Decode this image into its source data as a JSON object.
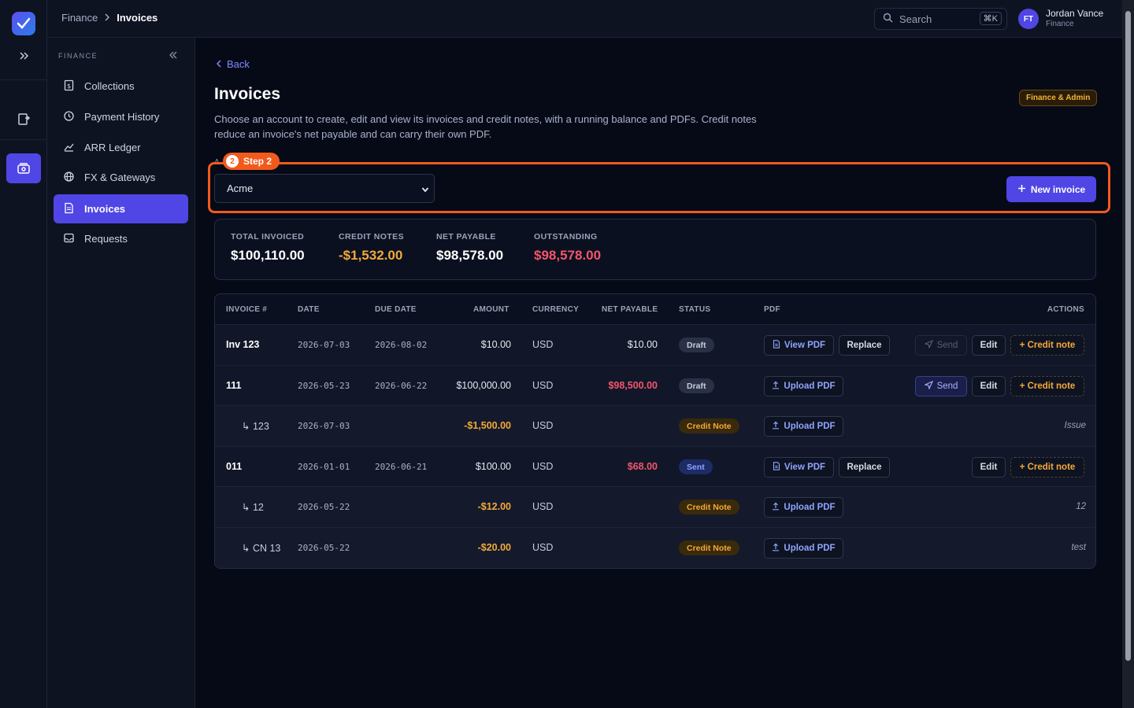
{
  "app": {
    "user_initials": "FT",
    "user_name": "Jordan Vance",
    "user_role": "Finance"
  },
  "breadcrumb": {
    "parent": "Finance",
    "current": "Invoices"
  },
  "search": {
    "placeholder": "Search",
    "shortcut": "⌘K"
  },
  "sidebar": {
    "section": "FINANCE",
    "items": [
      {
        "label": "Collections",
        "icon": "dollar-doc-icon"
      },
      {
        "label": "Payment History",
        "icon": "history-icon"
      },
      {
        "label": "ARR Ledger",
        "icon": "chart-icon"
      },
      {
        "label": "FX & Gateways",
        "icon": "globe-icon"
      },
      {
        "label": "Invoices",
        "icon": "document-icon",
        "active": true
      },
      {
        "label": "Requests",
        "icon": "inbox-icon"
      }
    ]
  },
  "page": {
    "back": "Back",
    "title": "Invoices",
    "description": "Choose an account to create, edit and view its invoices and credit notes, with a running balance and PDFs. Credit notes reduce an invoice's net payable and can carry their own PDF.",
    "role_badge": "Finance & Admin",
    "step_label": "Step 2",
    "step_number": "2",
    "account_label": "A",
    "account_selected": "Acme",
    "new_invoice": "New invoice"
  },
  "summary": {
    "total_invoiced_label": "TOTAL INVOICED",
    "total_invoiced": "$100,110.00",
    "credit_notes_label": "CREDIT NOTES",
    "credit_notes": "-$1,532.00",
    "net_payable_label": "NET PAYABLE",
    "net_payable": "$98,578.00",
    "outstanding_label": "OUTSTANDING",
    "outstanding": "$98,578.00"
  },
  "table": {
    "headers": {
      "invoice": "INVOICE #",
      "date": "DATE",
      "due": "DUE DATE",
      "amount": "AMOUNT",
      "currency": "CURRENCY",
      "net": "NET PAYABLE",
      "status": "STATUS",
      "pdf": "PDF",
      "actions": "ACTIONS"
    },
    "labels": {
      "view_pdf": "View PDF",
      "upload_pdf": "Upload PDF",
      "replace": "Replace",
      "send": "Send",
      "edit": "Edit",
      "credit_note": "+ Credit note"
    },
    "rows": [
      {
        "inv": "Inv 123",
        "date": "2026-07-03",
        "due": "2026-08-02",
        "amount": "$10.00",
        "currency": "USD",
        "net": "$10.00",
        "status": "Draft"
      },
      {
        "inv": "111",
        "date": "2026-05-23",
        "due": "2026-06-22",
        "amount": "$100,000.00",
        "currency": "USD",
        "net": "$98,500.00",
        "status": "Draft"
      },
      {
        "inv": "↳ 123",
        "date": "2026-07-03",
        "due": "",
        "amount": "-$1,500.00",
        "currency": "USD",
        "net": "",
        "status": "Credit Note",
        "note": "Issue"
      },
      {
        "inv": "011",
        "date": "2026-01-01",
        "due": "2026-06-21",
        "amount": "$100.00",
        "currency": "USD",
        "net": "$68.00",
        "status": "Sent"
      },
      {
        "inv": "↳ 12",
        "date": "2026-05-22",
        "due": "",
        "amount": "-$12.00",
        "currency": "USD",
        "net": "",
        "status": "Credit Note",
        "note": "12"
      },
      {
        "inv": "↳ CN 13",
        "date": "2026-05-22",
        "due": "",
        "amount": "-$20.00",
        "currency": "USD",
        "net": "",
        "status": "Credit Note",
        "note": "test"
      }
    ]
  }
}
